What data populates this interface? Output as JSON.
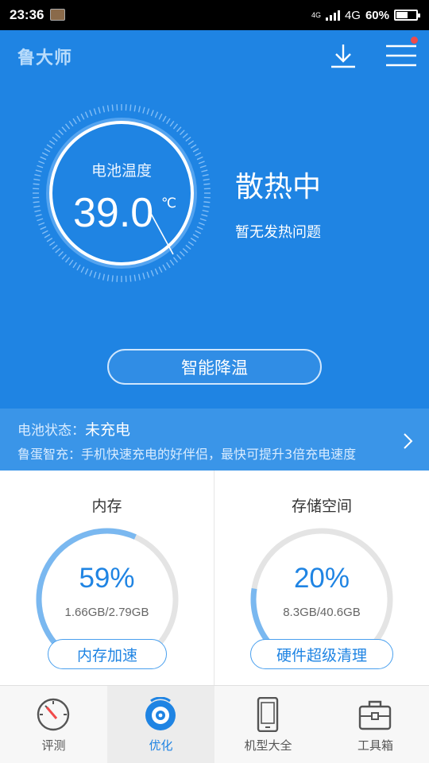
{
  "status_bar": {
    "time": "23:36",
    "network_small": "4G",
    "network": "4G",
    "battery_percent_text": "60%",
    "battery_level": 0.6
  },
  "header": {
    "app_name": "鲁大师",
    "icons": [
      "download-icon",
      "menu-icon"
    ],
    "notification_dot_color": "#f04a4a"
  },
  "battery_temp": {
    "title": "电池温度",
    "value": "39.0",
    "unit": "℃",
    "status": "散热中",
    "substatus": "暂无发热问题",
    "action_label": "智能降温"
  },
  "charge_info": {
    "state_label": "电池状态：",
    "state_value": "未充电",
    "promo": "鲁蛋智充：手机快速充电的好伴侣，最快可提升3倍充电速度"
  },
  "memory": {
    "title": "内存",
    "percent_text": "59%",
    "fraction": 0.59,
    "detail": "1.66GB/2.79GB",
    "action_label": "内存加速"
  },
  "storage": {
    "title": "存储空间",
    "percent_text": "20%",
    "fraction": 0.2,
    "detail": "8.3GB/40.6GB",
    "action_label": "硬件超级清理"
  },
  "bottom_nav": {
    "items": [
      {
        "label": "评测",
        "icon": "speedometer-icon"
      },
      {
        "label": "优化",
        "icon": "optimize-icon",
        "active": true
      },
      {
        "label": "机型大全",
        "icon": "phone-icon"
      },
      {
        "label": "工具箱",
        "icon": "toolbox-icon"
      }
    ]
  },
  "colors": {
    "primary_blue": "#1f84e3",
    "strip_blue": "#3a95e8",
    "ring_track": "#e4e4e4",
    "ring_fill": "#7ab8f0"
  }
}
